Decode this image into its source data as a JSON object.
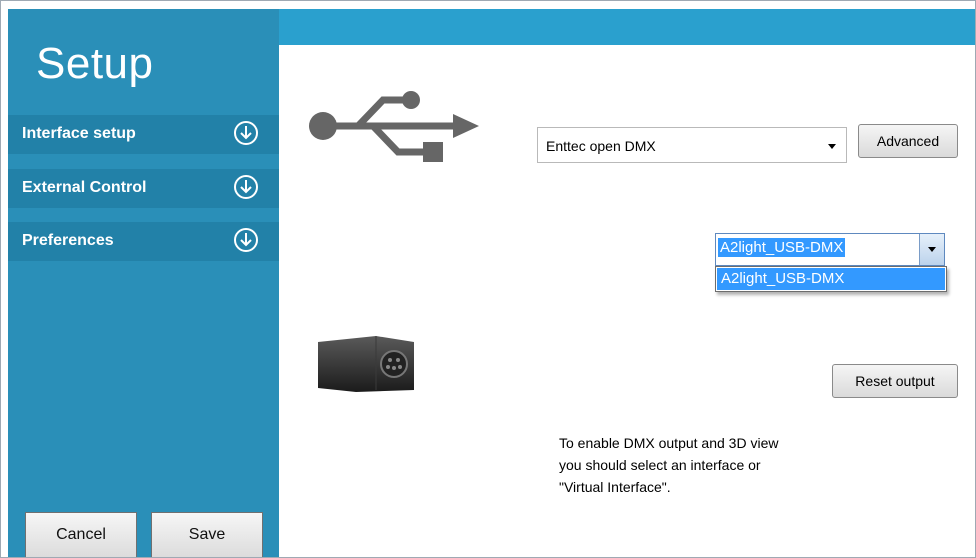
{
  "sidebar": {
    "title": "Setup",
    "items": [
      {
        "label": "Interface setup"
      },
      {
        "label": "External Control"
      },
      {
        "label": "Preferences"
      }
    ],
    "cancel_label": "Cancel",
    "save_label": "Save",
    "background_color": "#2a8fb8"
  },
  "topbar": {
    "color": "#2aa0ce"
  },
  "interface": {
    "selected": "Enttec open DMX",
    "advanced_label": "Advanced"
  },
  "device_combo": {
    "selected": "A2light_USB-DMX",
    "options": [
      "A2light_USB-DMX"
    ]
  },
  "reset_label": "Reset output",
  "note_lines": [
    "To enable DMX output and 3D view",
    "you should select an interface or",
    "\"Virtual Interface\"."
  ],
  "icons": [
    "usb-icon",
    "arrow-down-circle-icon",
    "dmx-device-image"
  ]
}
